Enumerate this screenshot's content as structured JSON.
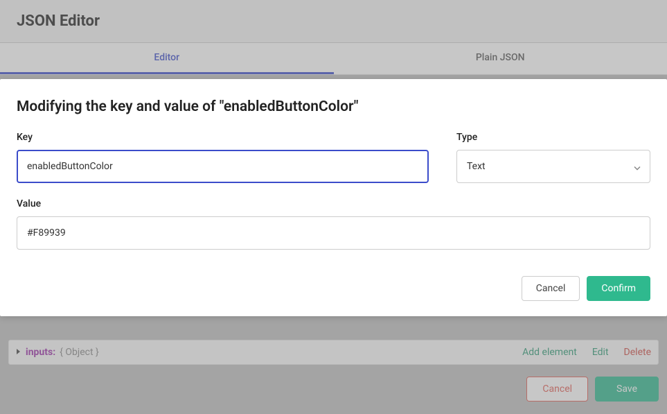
{
  "header": {
    "title": "JSON Editor"
  },
  "tabs": {
    "editor": "Editor",
    "plain": "Plain JSON"
  },
  "modal": {
    "title": "Modifying the key and value of \"enabledButtonColor\"",
    "key_label": "Key",
    "key_value": "enabledButtonColor",
    "type_label": "Type",
    "type_value": "Text",
    "value_label": "Value",
    "value_value": "#F89939",
    "cancel": "Cancel",
    "confirm": "Confirm"
  },
  "tree": {
    "key": "inputs:",
    "type": "{ Object }",
    "actions": {
      "add": "Add element",
      "edit": "Edit",
      "delete": "Delete"
    }
  },
  "footer": {
    "cancel": "Cancel",
    "save": "Save"
  }
}
